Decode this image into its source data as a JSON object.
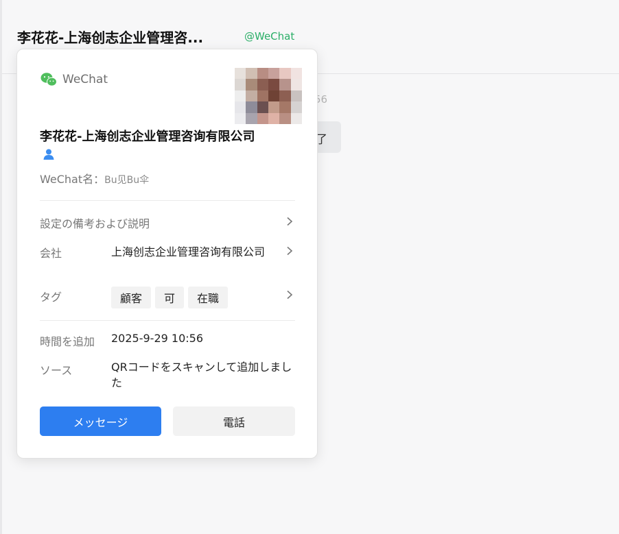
{
  "header": {
    "title": "李花花-上海创志企业管理咨...",
    "badge": "@WeChat"
  },
  "background": {
    "time_fragment": "56",
    "bubble_fragment": "了"
  },
  "card": {
    "app_label": "WeChat",
    "name": "李花花-上海创志企业管理咨询有限公司",
    "wechat_id_label": "WeChat名：",
    "wechat_id_value": "Bu见Bu伞",
    "remark_label": "設定の備考および説明",
    "company_label": "会社",
    "company_value": "上海创志企业管理咨询有限公司",
    "tags_label": "タグ",
    "tags": [
      "顧客",
      "可",
      "在職"
    ],
    "added_time_label": "時間を追加",
    "added_time_value": "2025-9-29 10:56",
    "source_label": "ソース",
    "source_value": "QRコードをスキャンして追加しました",
    "message_button": "メッセージ",
    "call_button": "電話"
  },
  "colors": {
    "accent_blue": "#2d7ef0",
    "wechat_green": "#2aae67",
    "person_icon_blue": "#3b8df0"
  },
  "icons": {
    "app": "wechat-icon",
    "person": "person-icon",
    "chevron": "chevron-right-icon"
  }
}
